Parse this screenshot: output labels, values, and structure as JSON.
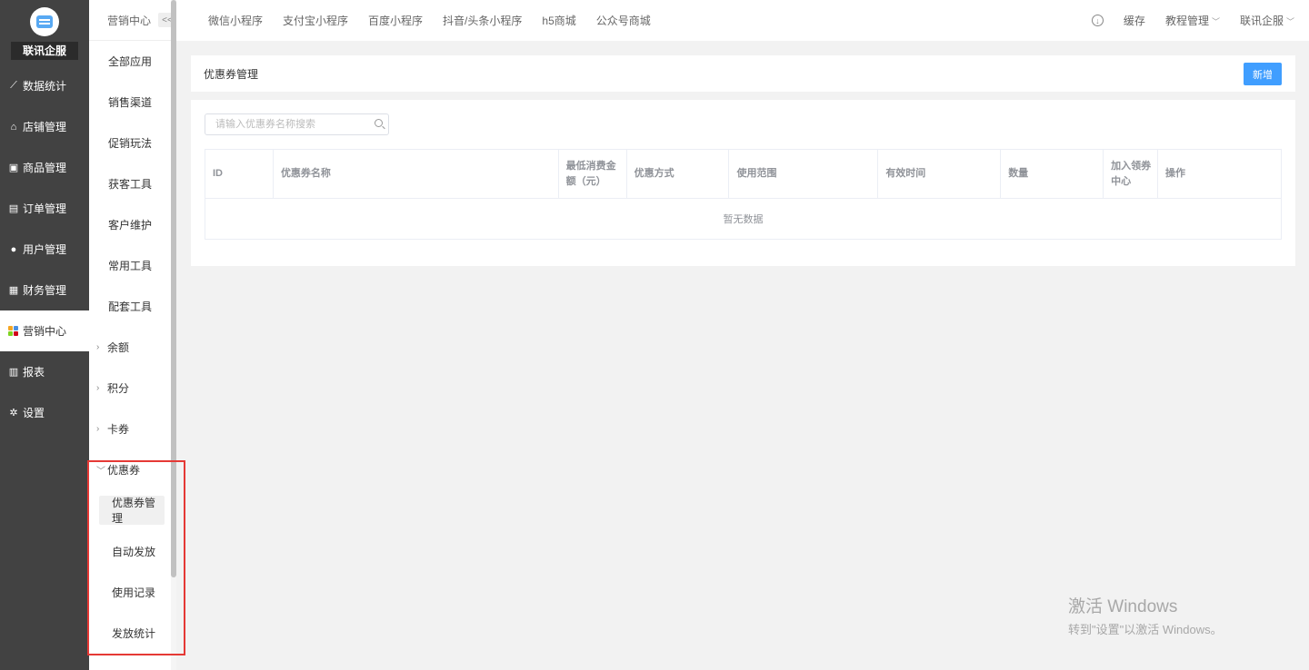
{
  "sidebar": {
    "brand": "联讯企服",
    "items": [
      {
        "label": "数据统计",
        "icon": "line-chart-icon",
        "glyph": "⟋"
      },
      {
        "label": "店铺管理",
        "icon": "store-icon",
        "glyph": "⌂"
      },
      {
        "label": "商品管理",
        "icon": "goods-icon",
        "glyph": "▣"
      },
      {
        "label": "订单管理",
        "icon": "order-icon",
        "glyph": "▤"
      },
      {
        "label": "用户管理",
        "icon": "user-icon",
        "glyph": "●"
      },
      {
        "label": "财务管理",
        "icon": "finance-icon",
        "glyph": "▦"
      },
      {
        "label": "营销中心",
        "icon": "marketing-icon",
        "glyph": ""
      },
      {
        "label": "报表",
        "icon": "report-icon",
        "glyph": "▥"
      },
      {
        "label": "设置",
        "icon": "settings-icon",
        "glyph": "✲"
      }
    ],
    "active_index": 6
  },
  "subnav": {
    "title": "营销中心",
    "collapse_label": "<<",
    "items": [
      {
        "label": "全部应用"
      },
      {
        "label": "销售渠道"
      },
      {
        "label": "促销玩法"
      },
      {
        "label": "获客工具"
      },
      {
        "label": "客户维护"
      },
      {
        "label": "常用工具"
      },
      {
        "label": "配套工具"
      }
    ],
    "groups": [
      {
        "label": "余额",
        "expanded": false
      },
      {
        "label": "积分",
        "expanded": false
      },
      {
        "label": "卡券",
        "expanded": false
      },
      {
        "label": "优惠券",
        "expanded": true
      }
    ],
    "coupon_children": [
      {
        "label": "优惠券管理",
        "active": true
      },
      {
        "label": "自动发放"
      },
      {
        "label": "使用记录"
      },
      {
        "label": "发放统计"
      }
    ]
  },
  "topbar": {
    "tabs": [
      "微信小程序",
      "支付宝小程序",
      "百度小程序",
      "抖音/头条小程序",
      "h5商城",
      "公众号商城"
    ],
    "cache": "缓存",
    "tutorial": "教程管理",
    "account": "联讯企服"
  },
  "page": {
    "title": "优惠券管理",
    "add_button": "新增",
    "search_placeholder": "请输入优惠券名称搜索",
    "table": {
      "columns": [
        "ID",
        "优惠券名称",
        "最低消费金额（元）",
        "优惠方式",
        "使用范围",
        "有效时间",
        "数量",
        "加入领券中心",
        "操作"
      ],
      "empty_text": "暂无数据"
    }
  },
  "watermark": {
    "line1": "激活 Windows",
    "line2": "转到\"设置\"以激活 Windows。"
  },
  "colors": {
    "sidebar_bg": "#424242",
    "primary": "#409eff",
    "highlight": "#e53935"
  }
}
